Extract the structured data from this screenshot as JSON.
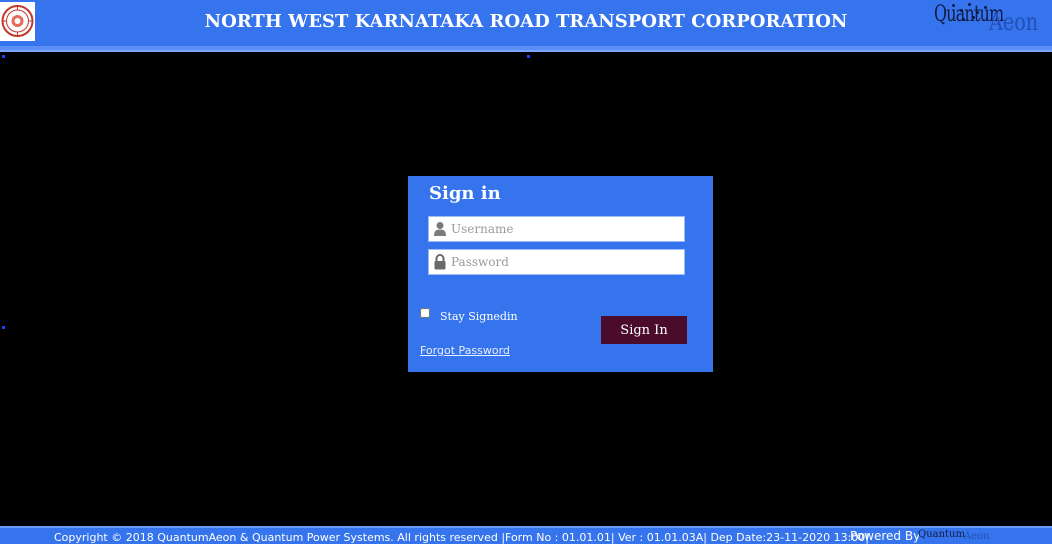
{
  "header": {
    "title": "NORTH WEST KARNATAKA ROAD TRANSPORT CORPORATION",
    "left_logo_icon": "nwkrtc-emblem-icon",
    "right_logo": {
      "part1": "Quantum",
      "part2": "Aeon"
    }
  },
  "signin": {
    "title": "Sign in",
    "username_placeholder": "Username",
    "username_value": "",
    "username_icon": "user-icon",
    "password_placeholder": "Password",
    "password_value": "",
    "password_icon": "lock-icon",
    "stay_signed_in_label": "Stay Signedin",
    "stay_signed_in_checked": false,
    "button_label": "Sign In",
    "forgot_password_label": "Forgot Password"
  },
  "footer": {
    "text": "Copyright © 2018 QuantumAeon & Quantum Power Systems. All rights reserved |Form No : 01.01.01| Ver : 01.01.03A|  Dep Date:23-11-2020 13:00|",
    "powered_by": "Powered By",
    "powered_logo": {
      "part1": "Quantum",
      "part2": "Aeon"
    }
  },
  "colors": {
    "background": "#000000",
    "header_bar": "#3574ec",
    "signin_box": "#3574ec",
    "signin_button": "#4b0c2c",
    "text": "#ffffff"
  }
}
